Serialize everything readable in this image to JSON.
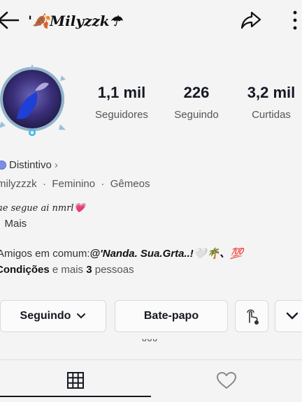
{
  "header": {
    "name": "'🍂Milyzzk☂"
  },
  "stats": [
    {
      "value": "1,1 mil",
      "label": "Seguidores"
    },
    {
      "value": "226",
      "label": "Seguindo"
    },
    {
      "value": "3,2 mil",
      "label": "Curtidas"
    }
  ],
  "badge": {
    "label": "Distintivo",
    "chevron": "›"
  },
  "info": {
    "handle": "milyzzzk",
    "gender": "Feminino",
    "sign": "Gêmeos",
    "separator": "·"
  },
  "bio": {
    "text": "ae segue ai nmrl💗",
    "more_label": "Mais",
    "more_prefix": ":"
  },
  "mutual": {
    "prefix": "Amigos em comum:",
    "friends": "@'Nanda. Sua.Grta..!🤍🌴、💯",
    "names": "Condições",
    "connector": "e mais",
    "count": "3",
    "suffix": "pessoas"
  },
  "buttons": {
    "following_label": "Seguindo",
    "chat_label": "Bate-papo"
  },
  "decor": {
    "dots": "ᴗᴗᴗ"
  },
  "colors": {
    "badge": "#7f8de6",
    "heart": "#ff4f86",
    "text": "#161823",
    "secondary": "#555555"
  },
  "icons": [
    "back-icon",
    "share-icon",
    "more-icon",
    "chevron-right-icon",
    "chevron-down-icon",
    "finger-tap-icon",
    "grid-icon",
    "heart-icon"
  ]
}
